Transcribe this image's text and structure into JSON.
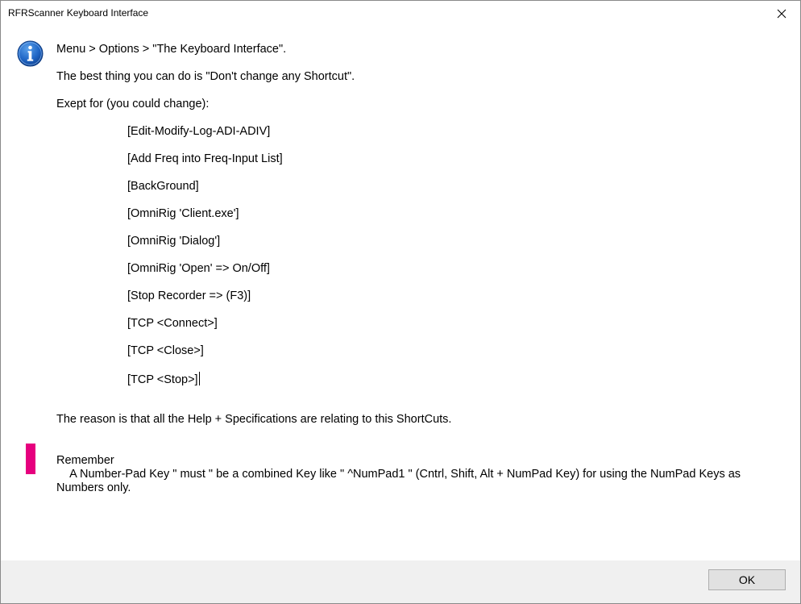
{
  "window": {
    "title": "RFRScanner Keyboard Interface",
    "close_glyph": "✕"
  },
  "icons": {
    "info": "info-icon",
    "close": "close-icon"
  },
  "message": {
    "path_line": "Menu > Options > \"The Keyboard Interface\".",
    "advice_line": "The best thing you can do is \"Don't change any Shortcut\".",
    "except_line": "Exept for (you could change):",
    "shortcuts": [
      "[Edit-Modify-Log-ADI-ADIV]",
      "[Add Freq into Freq-Input List]",
      "[BackGround]",
      "[OmniRig 'Client.exe']",
      "[OmniRig 'Dialog']",
      "[OmniRig 'Open' => On/Off]",
      "[Stop Recorder => (F3)]",
      "[TCP <Connect>]",
      "[TCP <Close>]",
      "[TCP <Stop>]"
    ],
    "reason_line": "The reason is that all the Help + Specifications are relating to this ShortCuts."
  },
  "remember": {
    "title": "Remember",
    "body": "    A Number-Pad Key \" must \" be a combined Key like \" ^NumPad1 \" (Cntrl, Shift, Alt + NumPad Key) for using the NumPad Keys as Numbers only."
  },
  "footer": {
    "ok_label": "OK"
  },
  "colors": {
    "accent": "#e6007e",
    "info_blue": "#1b5fb5",
    "footer_bg": "#f0f0f0"
  }
}
